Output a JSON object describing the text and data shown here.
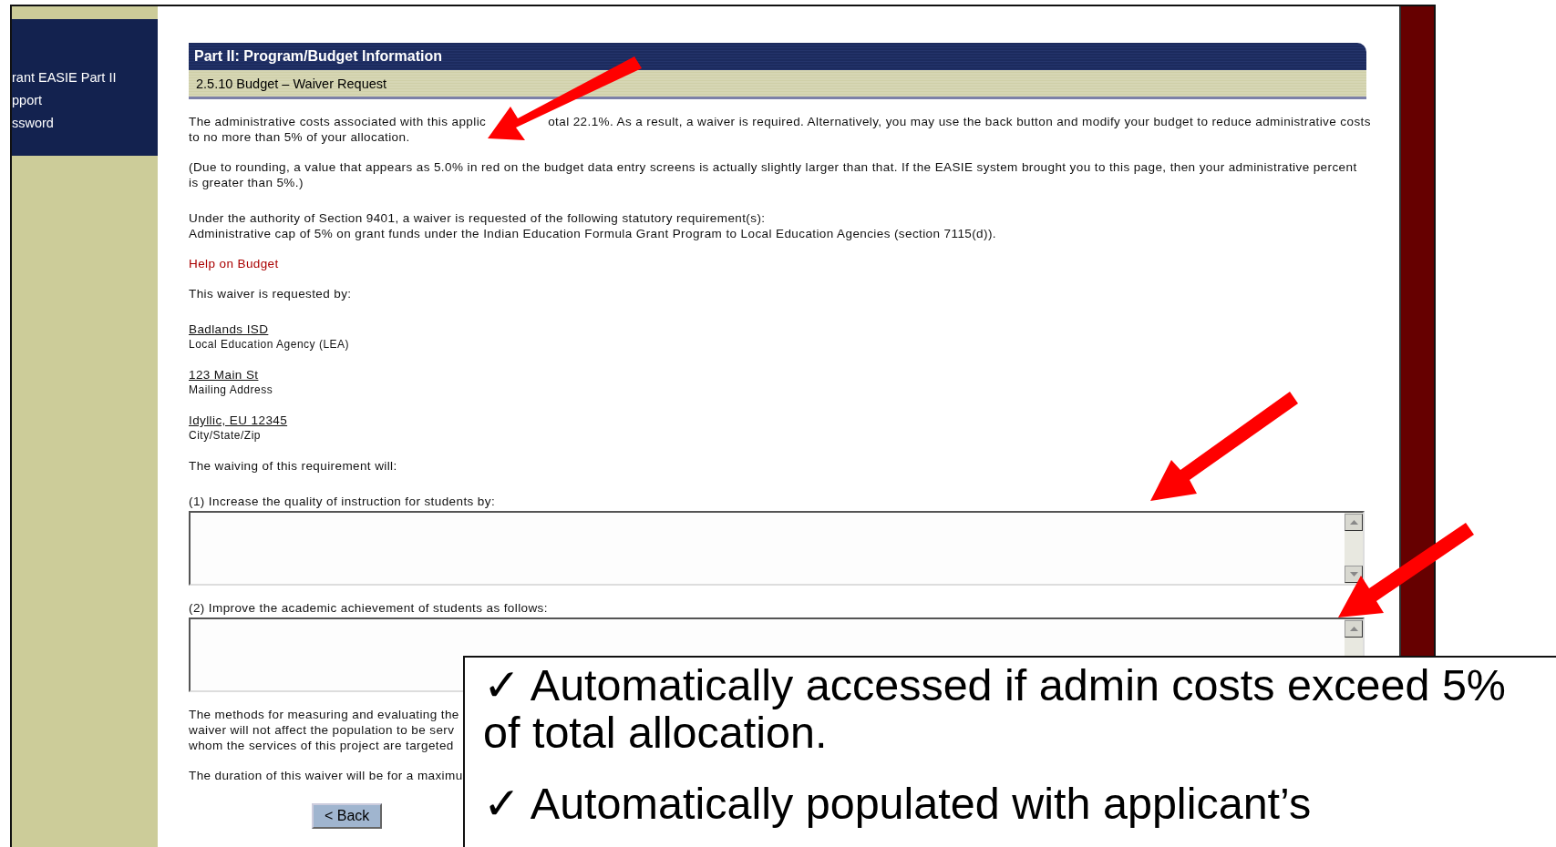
{
  "sidebar": {
    "items": [
      "rant EASIE Part II",
      "pport",
      "ssword"
    ]
  },
  "header": {
    "title": "Part II: Program/Budget Information",
    "subtitle": "2.5.10 Budget – Waiver Request"
  },
  "blocks": [
    {
      "kind": "split",
      "parts": [
        "The administrative costs associated with this applic",
        "otal 22.1%. As a result, a waiver is required. Alternatively, you may use the back button and modify your budget to reduce administrative costs"
      ],
      "rest": "to no more than 5% of your allocation."
    },
    {
      "kind": "paragraph",
      "text": "(Due to rounding, a value that appears as 5.0% in red on the budget data entry screens is actually slightly larger than that. If the EASIE system brought you to this page, then your administrative percent is greater than 5%.)"
    },
    {
      "kind": "lines",
      "lines": [
        "Under the authority of Section 9401, a waiver is requested of the following statutory requirement(s):",
        "Administrative cap of 5% on grant funds under the Indian Education Formula Grant Program to Local Education Agencies (section 7115(d))."
      ]
    },
    {
      "kind": "link",
      "text": "Help on Budget"
    },
    {
      "kind": "paragraph",
      "text": "This waiver is requested by:"
    },
    {
      "kind": "entry",
      "value": "Badlands ISD",
      "caption": "Local Education Agency (LEA)"
    },
    {
      "kind": "entry",
      "value": "123 Main St",
      "caption": "Mailing Address"
    },
    {
      "kind": "entry",
      "value": "Idyllic, EU 12345",
      "caption": "City/State/Zip"
    },
    {
      "kind": "paragraph",
      "text": "The waiving of this requirement will:"
    },
    {
      "kind": "textarea",
      "label": "(1) Increase the quality of instruction for students by:",
      "scroll_down": true
    },
    {
      "kind": "textarea",
      "label": "(2) Improve the academic achievement of students as follows:"
    },
    {
      "kind": "lines",
      "lines": [
        "The methods for measuring and evaluating the",
        "waiver will not affect the population to be serv",
        "whom the services of this project are targeted"
      ]
    },
    {
      "kind": "lines",
      "lines": [
        "The duration of this waiver will be for a maximu"
      ]
    },
    {
      "kind": "button",
      "text": "< Back"
    }
  ],
  "callout": {
    "mark": "✓",
    "bullets": [
      "Automatically accessed if admin costs exceed 5% of total allocation.",
      "Automatically populated with applicant’s"
    ]
  }
}
